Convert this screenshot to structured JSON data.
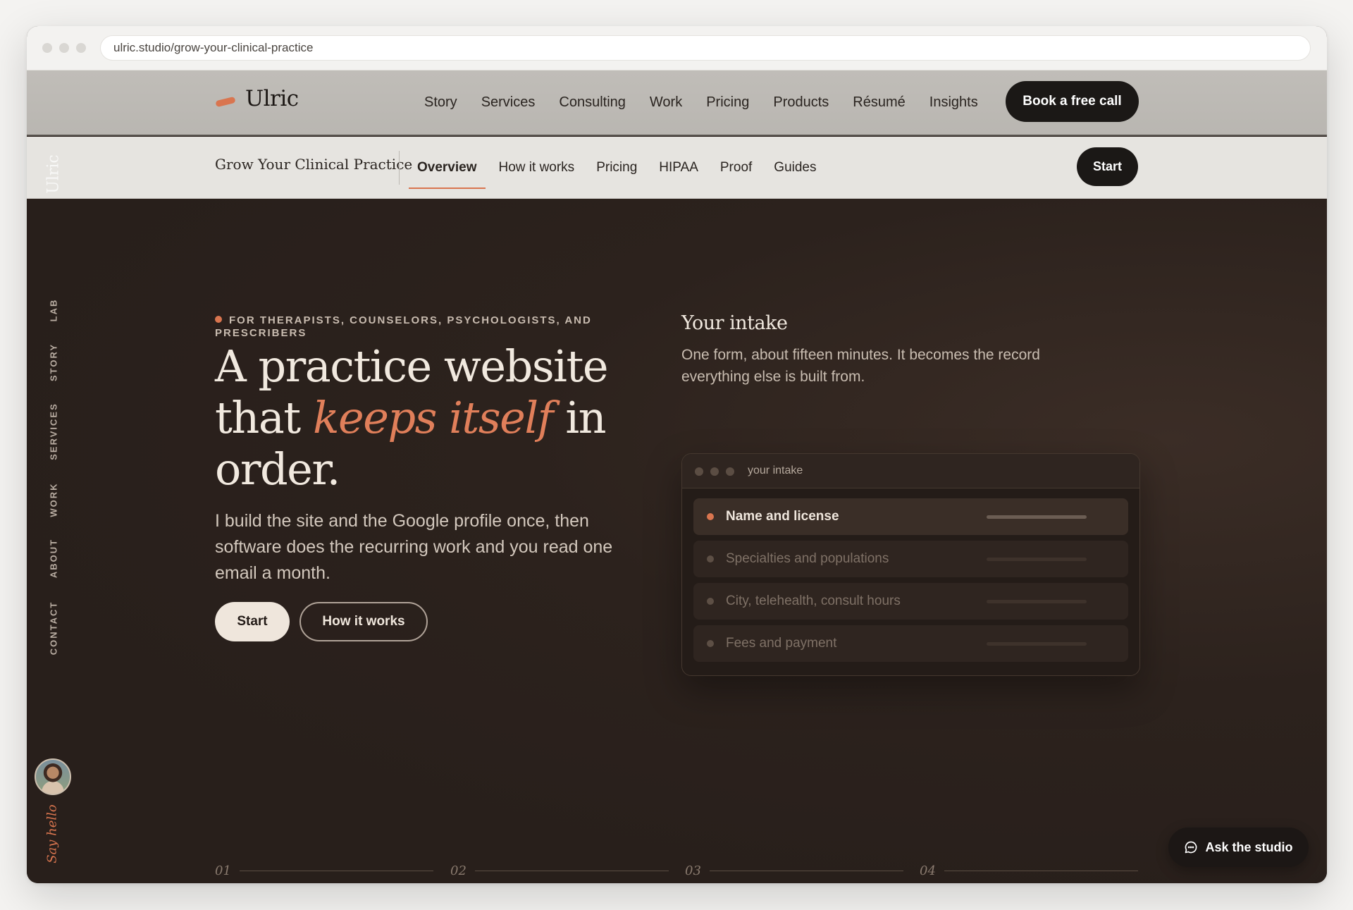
{
  "browser": {
    "url": "ulric.studio/grow-your-clinical-practice"
  },
  "nav": {
    "brand": "Ulric",
    "links": [
      "Story",
      "Services",
      "Consulting",
      "Work",
      "Pricing",
      "Products",
      "Résumé",
      "Insights"
    ],
    "cta": "Book a free call"
  },
  "subnav": {
    "title": "Grow Your Clinical Practice",
    "links": [
      "Overview",
      "How it works",
      "Pricing",
      "HIPAA",
      "Proof",
      "Guides"
    ],
    "active": "Overview",
    "cta": "Start"
  },
  "rail": {
    "logo": "Ulric",
    "links": [
      "LAB",
      "STORY",
      "SERVICES",
      "WORK",
      "ABOUT",
      "CONTACT"
    ],
    "say_hello": "Say hello"
  },
  "hero": {
    "eyebrow": "FOR THERAPISTS, COUNSELORS, PSYCHOLOGISTS, AND PRESCRIBERS",
    "headline_pre": "A practice website that ",
    "headline_em": "keeps itself",
    "headline_post": " in order.",
    "lede": "I build the site and the Google profile once, then software does the recurring work and you read one email a month.",
    "primary_cta": "Start",
    "secondary_cta": "How it works"
  },
  "intake": {
    "title": "Your intake",
    "description": "One form, about fifteen minutes. It becomes the record everything else is built from.",
    "card_title": "your intake",
    "rows": [
      {
        "label": "Name and license",
        "active": true
      },
      {
        "label": "Specialties and populations",
        "active": false
      },
      {
        "label": "City, telehealth, consult hours",
        "active": false
      },
      {
        "label": "Fees and payment",
        "active": false
      }
    ]
  },
  "steps": [
    "01",
    "02",
    "03",
    "04"
  ],
  "chat": {
    "label": "Ask the studio",
    "icon": "chat-bubble-icon"
  },
  "colors": {
    "accent": "#d9754f",
    "hero_bg": "#2a201c",
    "dark_button": "#1b1816"
  }
}
